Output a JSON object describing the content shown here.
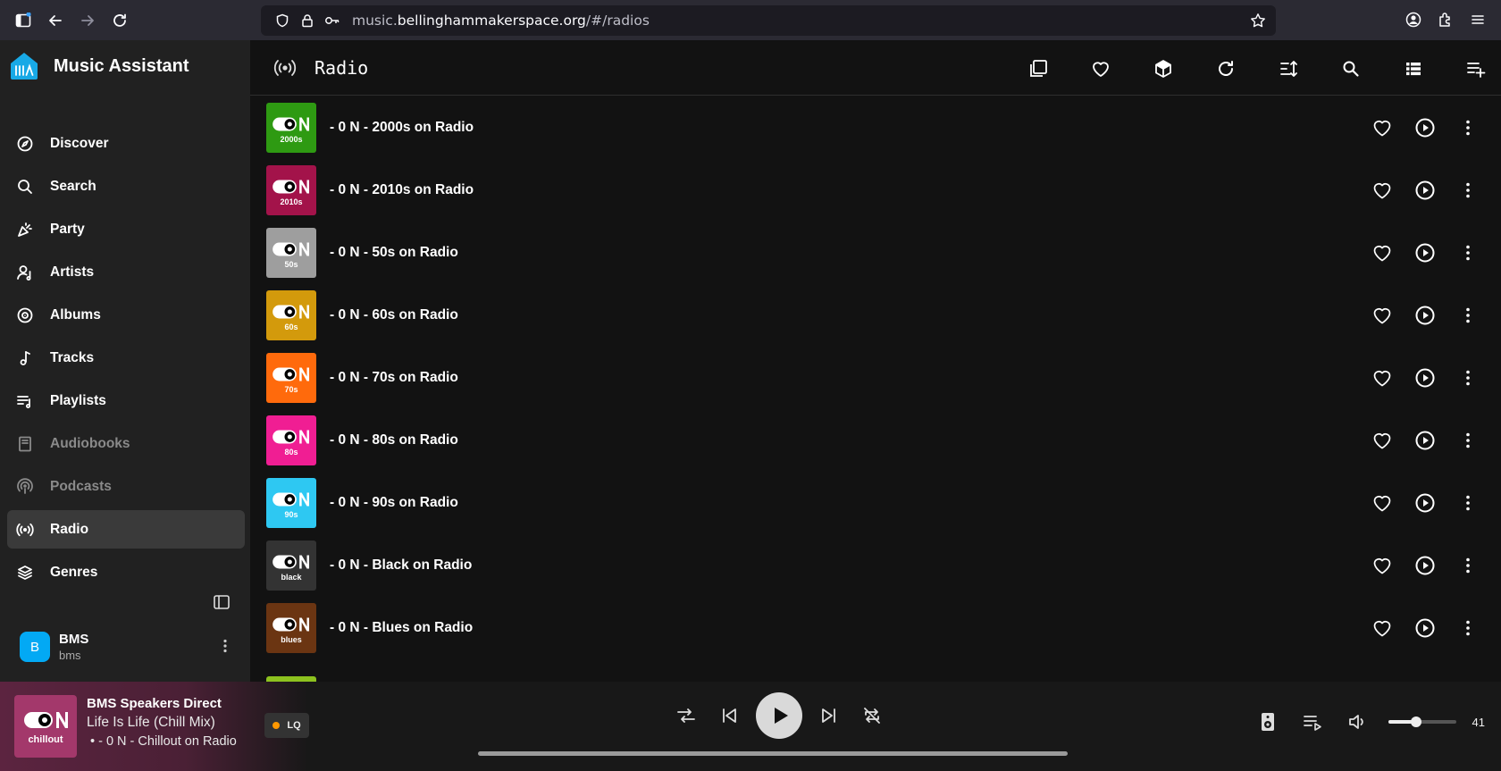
{
  "browser": {
    "url_prefix": "music.",
    "url_host": "bellinghammakerspace.org",
    "url_path": "/#/radios"
  },
  "app": {
    "title": "Music Assistant"
  },
  "sidebar": {
    "items": [
      {
        "label": "Discover",
        "icon": "compass-icon",
        "state": "normal"
      },
      {
        "label": "Search",
        "icon": "search-icon",
        "state": "normal"
      },
      {
        "label": "Party",
        "icon": "party-popper-icon",
        "state": "normal"
      },
      {
        "label": "Artists",
        "icon": "artist-icon",
        "state": "normal"
      },
      {
        "label": "Albums",
        "icon": "album-icon",
        "state": "normal"
      },
      {
        "label": "Tracks",
        "icon": "music-note-icon",
        "state": "normal"
      },
      {
        "label": "Playlists",
        "icon": "playlist-icon",
        "state": "normal"
      },
      {
        "label": "Audiobooks",
        "icon": "book-icon",
        "state": "disabled"
      },
      {
        "label": "Podcasts",
        "icon": "podcast-icon",
        "state": "disabled"
      },
      {
        "label": "Radio",
        "icon": "radio-icon",
        "state": "active"
      },
      {
        "label": "Genres",
        "icon": "genres-icon",
        "state": "normal"
      }
    ],
    "user": {
      "initial": "B",
      "name": "BMS",
      "handle": "bms"
    }
  },
  "header": {
    "title": "Radio"
  },
  "stations": [
    {
      "title": "- 0 N - 2000s on Radio",
      "tag": "2000s",
      "color": "#2e9a12"
    },
    {
      "title": "- 0 N - 2010s on Radio",
      "tag": "2010s",
      "color": "#a3134a"
    },
    {
      "title": "- 0 N - 50s on Radio",
      "tag": "50s",
      "color": "#9e9e9e"
    },
    {
      "title": "- 0 N - 60s on Radio",
      "tag": "60s",
      "color": "#d39a0c"
    },
    {
      "title": "- 0 N - 70s on Radio",
      "tag": "70s",
      "color": "#ff6a0c"
    },
    {
      "title": "- 0 N - 80s on Radio",
      "tag": "80s",
      "color": "#f01e93"
    },
    {
      "title": "- 0 N - 90s on Radio",
      "tag": "90s",
      "color": "#2ec8f2"
    },
    {
      "title": "- 0 N - Black on Radio",
      "tag": "black",
      "color": "#333333"
    },
    {
      "title": "- 0 N - Blues on Radio",
      "tag": "blues",
      "color": "#6b3512"
    }
  ],
  "player": {
    "device": "BMS Speakers Direct",
    "track": "Life Is Life (Chill Mix)",
    "station": "• - 0 N - Chillout on Radio",
    "thumb_tag": "chillout",
    "thumb_color": "#a3386b",
    "quality": "LQ",
    "volume": 41,
    "volume_label": "41"
  }
}
